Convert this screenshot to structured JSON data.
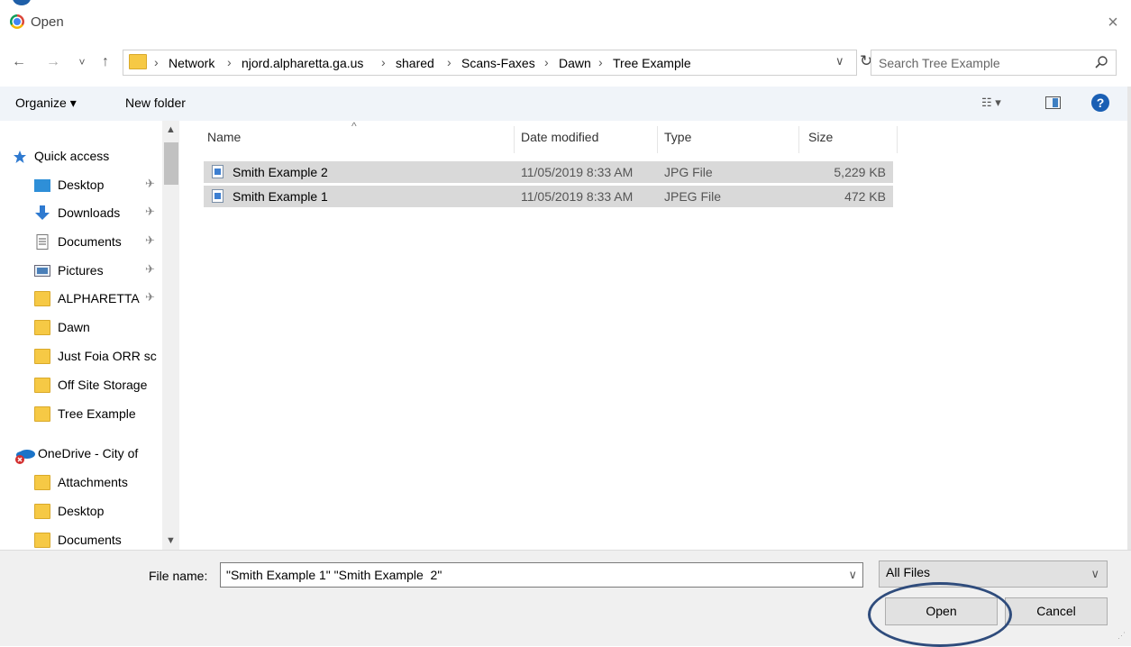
{
  "window": {
    "title": "Open",
    "close_glyph": "×"
  },
  "nav": {
    "back_glyph": "←",
    "forward_glyph": "→",
    "recent_glyph": "˅",
    "up_glyph": "↑",
    "breadcrumbs": [
      "Network",
      "njord.alpharetta.ga.us",
      "shared",
      "Scans-Faxes",
      "Dawn",
      "Tree Example"
    ],
    "separator": "›",
    "dropdown_glyph": "∨",
    "refresh_glyph": "↻",
    "search_placeholder": "Search Tree Example"
  },
  "toolbar": {
    "organize_label": "Organize ▾",
    "new_folder_label": "New folder",
    "view_glyph": "☷ ▾",
    "help_glyph": "?"
  },
  "sidebar": {
    "quick_access_label": "Quick access",
    "items": [
      {
        "label": "Desktop",
        "icon": "desktop-icon",
        "pinned": true
      },
      {
        "label": "Downloads",
        "icon": "downloads-icon",
        "pinned": true
      },
      {
        "label": "Documents",
        "icon": "documents-icon",
        "pinned": true
      },
      {
        "label": "Pictures",
        "icon": "pictures-icon",
        "pinned": true
      },
      {
        "label": "ALPHARETTA",
        "icon": "folder-icon",
        "pinned": true
      },
      {
        "label": "Dawn",
        "icon": "folder-icon",
        "pinned": false
      },
      {
        "label": "Just Foia ORR sc",
        "icon": "folder-icon",
        "pinned": false
      },
      {
        "label": "Off Site Storage",
        "icon": "folder-icon",
        "pinned": false
      },
      {
        "label": "Tree Example",
        "icon": "folder-icon",
        "pinned": false
      }
    ],
    "onedrive_label": "OneDrive - City of",
    "onedrive_items": [
      {
        "label": "Attachments",
        "icon": "folder-icon"
      },
      {
        "label": "Desktop",
        "icon": "folder-icon"
      },
      {
        "label": "Documents",
        "icon": "folder-icon"
      }
    ],
    "pin_glyph": "✈"
  },
  "file_list": {
    "columns": [
      "Name",
      "Date modified",
      "Type",
      "Size"
    ],
    "sort_glyph": "^",
    "rows": [
      {
        "name": "Smith Example  2",
        "date": "11/05/2019 8:33 AM",
        "type": "JPG File",
        "size": "5,229 KB"
      },
      {
        "name": "Smith Example 1",
        "date": "11/05/2019 8:33 AM",
        "type": "JPEG File",
        "size": "472 KB"
      }
    ]
  },
  "bottom": {
    "file_name_label": "File name:",
    "file_name_value": "\"Smith Example 1\" \"Smith Example  2\"",
    "file_type_value": "All Files",
    "dropdown_glyph": "∨",
    "open_label": "Open",
    "cancel_label": "Cancel"
  },
  "colors": {
    "toolbar_bg": "#f0f4f9",
    "selected_row": "#d9d9d9",
    "annotation_circle": "#2f4c7c",
    "help_blue": "#1a5fb4"
  }
}
